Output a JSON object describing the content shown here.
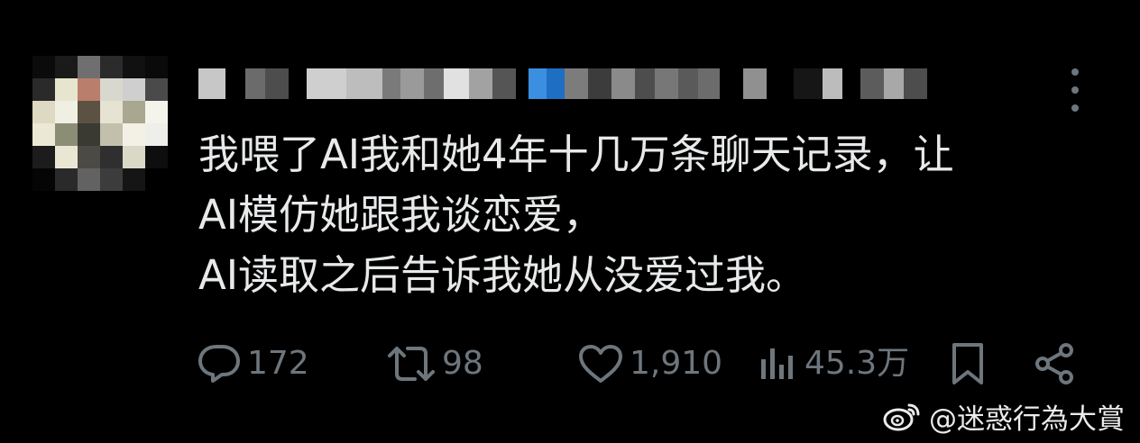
{
  "post": {
    "lines": [
      "我喂了AI我和她4年十几万条聊天记录，让",
      "AI模仿她跟我谈恋爱，",
      "AI读取之后告诉我她从没爱过我。"
    ]
  },
  "actions": {
    "reply_count": "172",
    "repost_count": "98",
    "like_count": "1,910",
    "views_count": "45.3万"
  },
  "icons": {
    "reply": "reply-icon",
    "repost": "repost-icon",
    "like": "heart-icon",
    "views": "views-icon",
    "bookmark": "bookmark-icon",
    "share": "share-icon",
    "more": "more-icon"
  },
  "watermark": {
    "text": "@迷惑行為大賞"
  },
  "colors": {
    "background": "#000000",
    "text": "#e7e9ea",
    "muted": "#6e767d"
  }
}
